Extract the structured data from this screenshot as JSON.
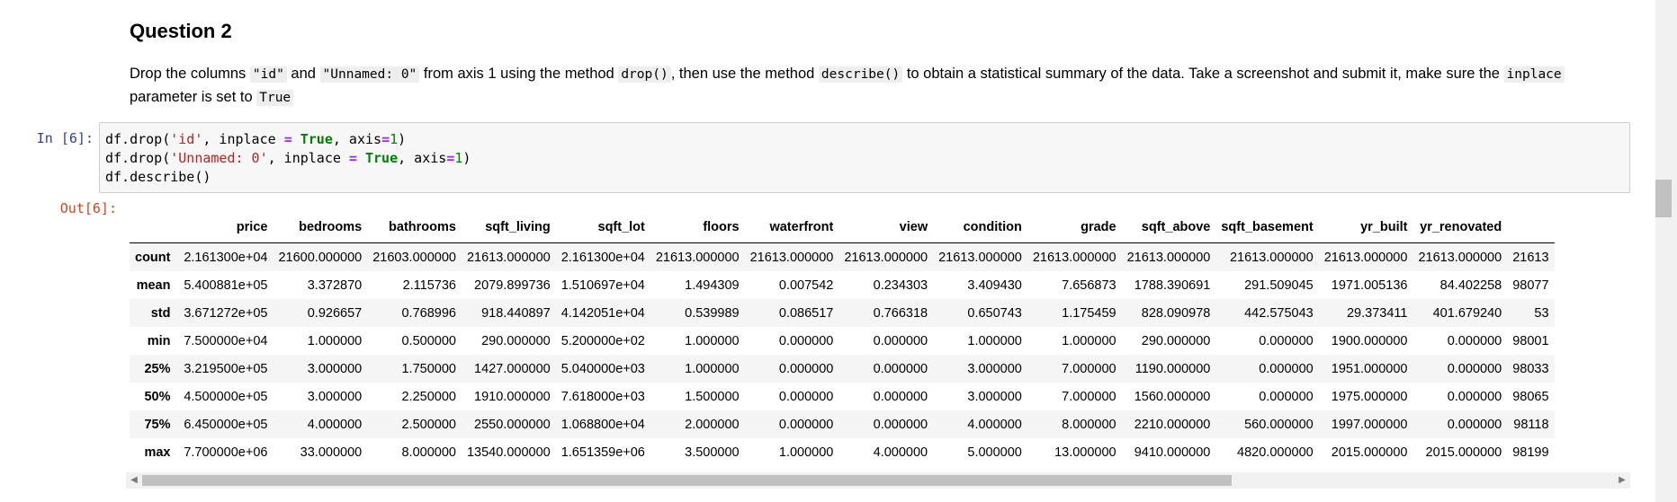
{
  "markdown": {
    "heading": "Question 2",
    "para": {
      "t1": "Drop the columns ",
      "c1": "\"id\"",
      "t2": " and ",
      "c2": "\"Unnamed: 0\"",
      "t3": " from axis 1 using the method ",
      "c3": "drop()",
      "t4": ", then use the method ",
      "c4": "describe()",
      "t5": " to obtain a statistical summary of the data. Take a screenshot and submit it, make sure the ",
      "c5": "inplace",
      "t6": " parameter is set to ",
      "c6": "True"
    }
  },
  "cell": {
    "in_prompt": "In [6]:",
    "out_prompt": "Out[6]:",
    "code": {
      "l1a": "df.drop(",
      "l1b": "'id'",
      "l1c": ", inplace ",
      "l1d": "=",
      "l1e": " ",
      "l1f": "True",
      "l1g": ", axis",
      "l1h": "=",
      "l1i": "1",
      "l1j": ")",
      "l2a": "df.drop(",
      "l2b": "'Unnamed: 0'",
      "l2c": ", inplace ",
      "l2d": "=",
      "l2e": " ",
      "l2f": "True",
      "l2g": ", axis",
      "l2h": "=",
      "l2i": "1",
      "l2j": ")",
      "l3": "df.describe()"
    }
  },
  "table": {
    "columns": [
      "price",
      "bedrooms",
      "bathrooms",
      "sqft_living",
      "sqft_lot",
      "floors",
      "waterfront",
      "view",
      "condition",
      "grade",
      "sqft_above",
      "sqft_basement",
      "yr_built",
      "yr_renovated"
    ],
    "rows": [
      {
        "label": "count",
        "cells": [
          "2.161300e+04",
          "21600.000000",
          "21603.000000",
          "21613.000000",
          "2.161300e+04",
          "21613.000000",
          "21613.000000",
          "21613.000000",
          "21613.000000",
          "21613.000000",
          "21613.000000",
          "21613.000000",
          "21613.000000",
          "21613.000000",
          "21613"
        ]
      },
      {
        "label": "mean",
        "cells": [
          "5.400881e+05",
          "3.372870",
          "2.115736",
          "2079.899736",
          "1.510697e+04",
          "1.494309",
          "0.007542",
          "0.234303",
          "3.409430",
          "7.656873",
          "1788.390691",
          "291.509045",
          "1971.005136",
          "84.402258",
          "98077"
        ]
      },
      {
        "label": "std",
        "cells": [
          "3.671272e+05",
          "0.926657",
          "0.768996",
          "918.440897",
          "4.142051e+04",
          "0.539989",
          "0.086517",
          "0.766318",
          "0.650743",
          "1.175459",
          "828.090978",
          "442.575043",
          "29.373411",
          "401.679240",
          "53"
        ]
      },
      {
        "label": "min",
        "cells": [
          "7.500000e+04",
          "1.000000",
          "0.500000",
          "290.000000",
          "5.200000e+02",
          "1.000000",
          "0.000000",
          "0.000000",
          "1.000000",
          "1.000000",
          "290.000000",
          "0.000000",
          "1900.000000",
          "0.000000",
          "98001"
        ]
      },
      {
        "label": "25%",
        "cells": [
          "3.219500e+05",
          "3.000000",
          "1.750000",
          "1427.000000",
          "5.040000e+03",
          "1.000000",
          "0.000000",
          "0.000000",
          "3.000000",
          "7.000000",
          "1190.000000",
          "0.000000",
          "1951.000000",
          "0.000000",
          "98033"
        ]
      },
      {
        "label": "50%",
        "cells": [
          "4.500000e+05",
          "3.000000",
          "2.250000",
          "1910.000000",
          "7.618000e+03",
          "1.500000",
          "0.000000",
          "0.000000",
          "3.000000",
          "7.000000",
          "1560.000000",
          "0.000000",
          "1975.000000",
          "0.000000",
          "98065"
        ]
      },
      {
        "label": "75%",
        "cells": [
          "6.450000e+05",
          "4.000000",
          "2.500000",
          "2550.000000",
          "1.068800e+04",
          "2.000000",
          "0.000000",
          "0.000000",
          "4.000000",
          "8.000000",
          "2210.000000",
          "560.000000",
          "1997.000000",
          "0.000000",
          "98118"
        ]
      },
      {
        "label": "max",
        "cells": [
          "7.700000e+06",
          "33.000000",
          "8.000000",
          "13540.000000",
          "1.651359e+06",
          "3.500000",
          "1.000000",
          "4.000000",
          "5.000000",
          "13.000000",
          "9410.000000",
          "4820.000000",
          "2015.000000",
          "2015.000000",
          "98199"
        ]
      }
    ]
  },
  "scroll": {
    "hscroll_fraction": 0.74,
    "left_arrow": "◀",
    "right_arrow": "▶"
  }
}
